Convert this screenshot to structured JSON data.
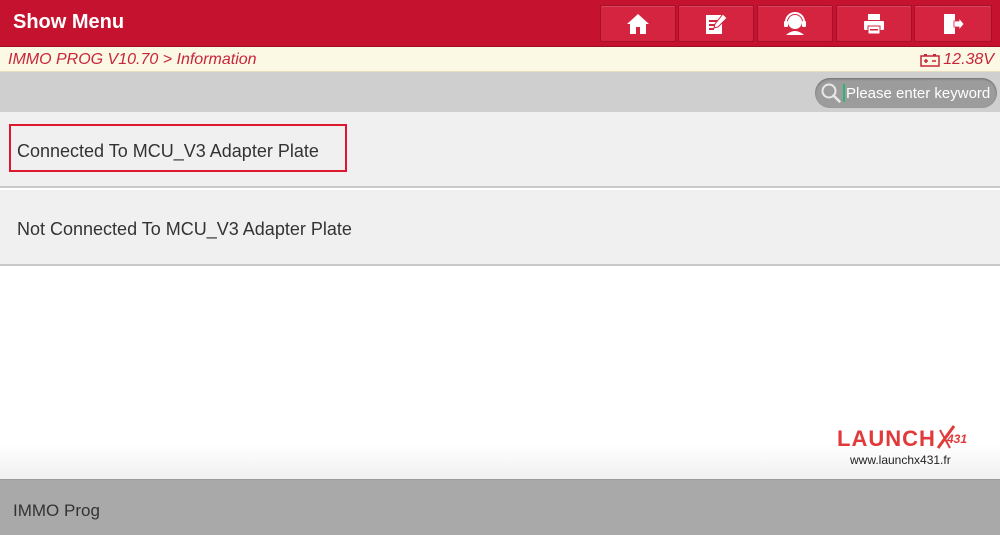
{
  "header": {
    "title": "Show Menu",
    "buttons": [
      {
        "name": "home",
        "icon": "home-icon"
      },
      {
        "name": "report",
        "icon": "edit-icon"
      },
      {
        "name": "feedback",
        "icon": "support-icon"
      },
      {
        "name": "print",
        "icon": "printer-icon"
      },
      {
        "name": "exit",
        "icon": "exit-icon"
      }
    ]
  },
  "breadcrumb": {
    "path": "IMMO PROG V10.70 > Information",
    "voltage": "12.38V",
    "voltage_icon": "battery-icon"
  },
  "search": {
    "placeholder": "Please enter keyword",
    "icon": "search-icon"
  },
  "list": {
    "items": [
      {
        "label": "Connected To MCU_V3 Adapter Plate",
        "highlighted": true
      },
      {
        "label": "Not Connected To MCU_V3 Adapter Plate",
        "highlighted": false
      }
    ]
  },
  "logo": {
    "brand": "LAUNCH",
    "model": "431",
    "url": "www.launchx431.fr"
  },
  "footer": {
    "app_name": "IMMO Prog"
  },
  "colors": {
    "header_bg": "#c5122e",
    "accent_text": "#c8253b",
    "highlight_border": "#e0182f",
    "footer_bg": "#a9a9a9"
  }
}
